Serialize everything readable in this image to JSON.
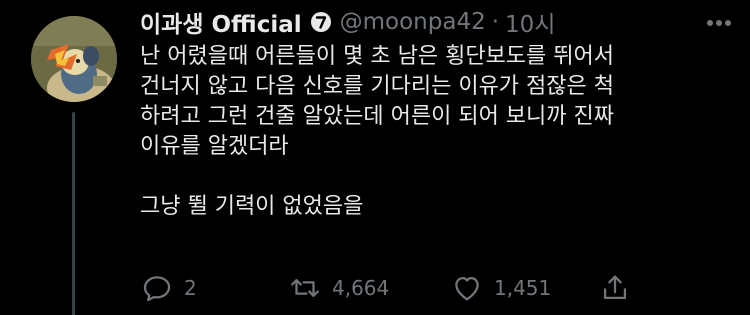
{
  "author": {
    "display_name": "이과생 Official",
    "handle": "@moonpa42",
    "separator": "·",
    "time": "10시",
    "verified": true,
    "avatar_icon": "cartoon-character-avatar"
  },
  "tweet": {
    "lines": [
      "난 어렸을때 어른들이 몇 초 남은 횡단보도를 뛰어서",
      "건너지 않고 다음 신호를 기다리는 이유가 점잖은 척",
      "하려고 그런 건줄 알았는데 어른이 되어 보니까 진짜",
      "이유를 알겠더라",
      "",
      "그냥 뛸 기력이 없었음을"
    ]
  },
  "actions": {
    "reply_count": "2",
    "retweet_count": "4,664",
    "like_count": "1,451"
  },
  "colors": {
    "background": "#000000",
    "text": "#e7e9ea",
    "muted": "#71767b"
  }
}
